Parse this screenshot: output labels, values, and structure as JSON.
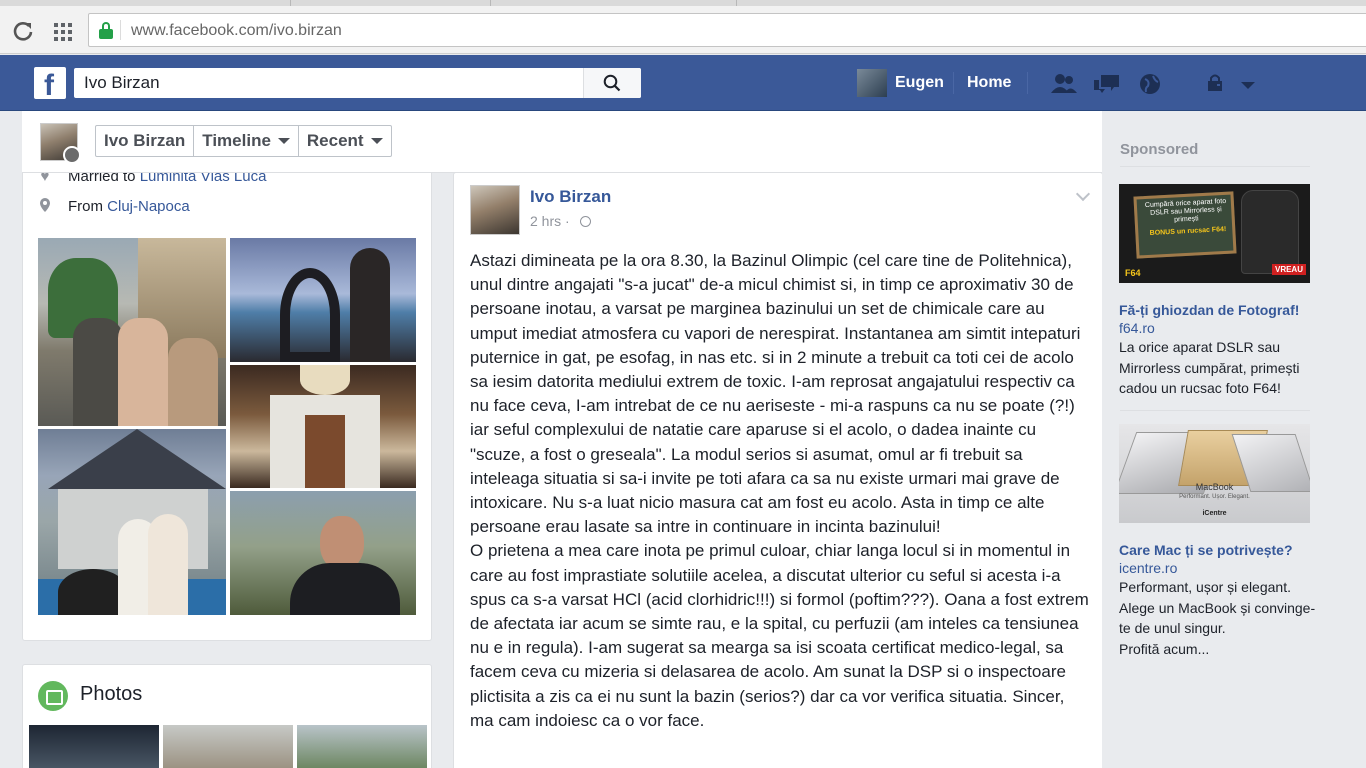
{
  "browser": {
    "url": "www.facebook.com/ivo.birzan"
  },
  "topbar": {
    "logo": "f",
    "search_value": "Ivo Birzan",
    "user_name": "Eugen",
    "home_label": "Home",
    "icons": [
      "friend-requests-icon",
      "messages-icon",
      "notifications-globe-icon",
      "privacy-lock-icon",
      "account-menu-caret-icon"
    ]
  },
  "profile_nav": {
    "name": "Ivo Birzan",
    "timeline": "Timeline",
    "recent": "Recent"
  },
  "intro": {
    "married_label": "Married to ",
    "married_to": "Luminita Vlas Luca",
    "from_label": "From ",
    "from_place": "Cluj-Napoca"
  },
  "photos": {
    "title": "Photos"
  },
  "post": {
    "author": "Ivo Birzan",
    "time": "2 hrs",
    "body": "Astazi dimineata pe la ora 8.30, la Bazinul Olimpic (cel care tine de Politehnica), unul dintre angajati \"s-a jucat\" de-a micul chimist si, in timp ce aproximativ 30 de persoane inotau, a varsat pe marginea bazinului un set de chimicale care au umput imediat atmosfera cu vapori de nerespirat. Instantanea am simtit intepaturi puternice in gat, pe esofag, in nas etc. si in 2 minute a trebuit ca toti cei de acolo sa iesim datorita mediului extrem de toxic. I-am reprosat angajatului respectiv ca nu face ceva, I-am intrebat de ce nu aeriseste - mi-a raspuns ca nu se poate (?!) iar seful complexului de natatie care aparuse si el acolo, o dadea inainte cu \"scuze, a fost o greseala\". La modul serios si asumat, omul ar fi trebuit sa inteleaga situatia si sa-i invite pe toti afara ca sa nu existe urmari mai grave de intoxicare. Nu s-a luat nicio masura cat am fost eu acolo. Asta in timp ce alte persoane erau lasate sa intre in continuare in incinta bazinului!\nO prietena a mea care inota pe primul culoar, chiar langa locul si in momentul in care au fost imprastiate solutiile acelea, a discutat ulterior cu seful si acesta i-a spus ca s-a varsat HCl (acid clorhidric!!!) si formol (poftim???). Oana a fost extrem de afectata iar acum se simte rau, e la spital, cu perfuzii (am inteles ca tensiunea nu e in regula). I-am sugerat sa mearga sa isi scoata certificat medico-legal, sa facem ceva cu mizeria si delasarea de acolo. Am sunat la DSP si o inspectoare plictisita a zis ca ei nu sunt la bazin (serios?) dar ca vor verifica situatia. Sincer, ma cam indoiesc ca o vor face."
  },
  "sponsored": {
    "label": "Sponsored",
    "ads": [
      {
        "image_text_1": "Cumpără orice aparat foto DSLR sau Mirrorless și primești",
        "image_text_2": "BONUS un rucsac F64!",
        "image_brand": "F64",
        "image_cta": "VREAU",
        "title": "Fă-ți ghiozdan de Fotograf!",
        "domain": "f64.ro",
        "text": "La orice aparat DSLR sau Mirrorless cumpărat, primești cadou un rucsac foto F64!"
      },
      {
        "image_text_1": "MacBook",
        "image_text_2": "Performant. Ușor. Elegant.",
        "image_brand": "iCentre",
        "title": "Care Mac ți se potrivește?",
        "domain": "icentre.ro",
        "text": "Performant, ușor și elegant.\nAlege un MacBook și convinge-te de unul singur.\nProfită acum..."
      }
    ]
  },
  "colors": {
    "fb_blue": "#3b5998",
    "link": "#365899",
    "page_bg": "#e9ebee"
  }
}
